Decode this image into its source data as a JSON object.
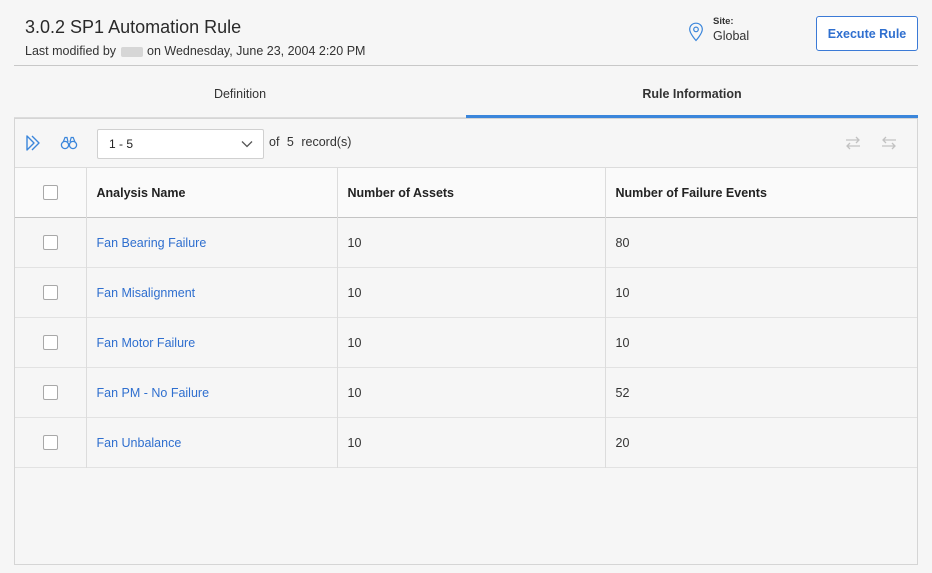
{
  "header": {
    "title": "3.0.2 SP1 Automation Rule",
    "modified_prefix": "Last modified by",
    "modified_suffix": "on Wednesday, June 23, 2004 2:20 PM",
    "site_label": "Site:",
    "site_value": "Global",
    "execute_label": "Execute Rule"
  },
  "tabs": [
    {
      "label": "Definition",
      "active": false
    },
    {
      "label": "Rule Information",
      "active": true
    }
  ],
  "toolbar": {
    "pager_value": "1 - 5",
    "of_label": "of",
    "record_count": "5",
    "records_label": "record(s)"
  },
  "grid": {
    "columns": [
      "Analysis Name",
      "Number of Assets",
      "Number of Failure Events"
    ],
    "rows": [
      {
        "name": "Fan Bearing Failure",
        "assets": "10",
        "events": "80"
      },
      {
        "name": "Fan Misalignment",
        "assets": "10",
        "events": "10"
      },
      {
        "name": "Fan Motor Failure",
        "assets": "10",
        "events": "10"
      },
      {
        "name": "Fan PM - No Failure",
        "assets": "10",
        "events": "52"
      },
      {
        "name": "Fan Unbalance",
        "assets": "10",
        "events": "20"
      }
    ]
  },
  "icons": {
    "site": "location-pin-icon",
    "expand": "expand-icon",
    "find": "binoculars-icon",
    "dropdown": "chevron-down-icon",
    "swap": "swap-icon",
    "swap_reverse": "swap-reverse-icon"
  },
  "colors": {
    "accent": "#3b86db",
    "link": "#2f6fcf",
    "border": "#d5d5d5",
    "background": "#f6f6f6"
  }
}
